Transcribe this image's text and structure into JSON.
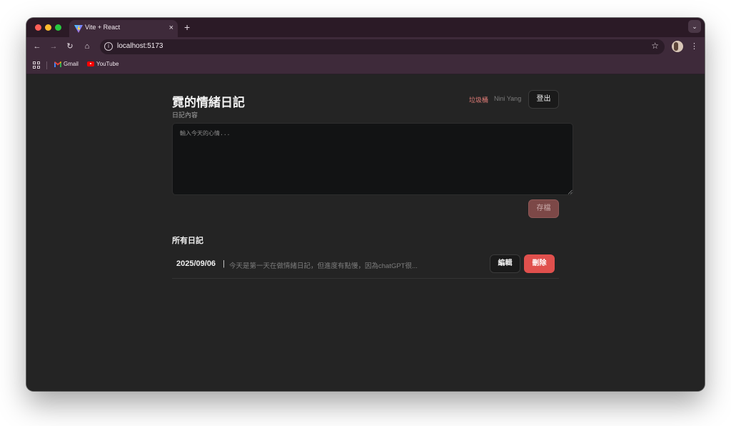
{
  "browser": {
    "tab_title": "Vite + React",
    "tab_close": "×",
    "new_tab": "+",
    "tab_menu": "⌄",
    "url": "localhost:5173",
    "nav": {
      "back": "←",
      "forward": "→",
      "reload": "↻",
      "home": "⌂"
    },
    "star": "☆",
    "menu": "⋮",
    "bookmarks": [
      {
        "label": "Gmail",
        "icon": "gmail-icon"
      },
      {
        "label": "YouTube",
        "icon": "youtube-icon"
      }
    ]
  },
  "app": {
    "title": "霓的情緒日記",
    "trash_link": "垃圾桶",
    "username": "Nini Yang",
    "logout_label": "登出",
    "field_label": "日記內容",
    "input_placeholder": "輸入今天的心情...",
    "input_value": "",
    "save_label": "存檔",
    "section_title": "所有日記",
    "entries": [
      {
        "date": "2025/09/06",
        "separator": "|",
        "preview": "今天是第一天在做情緒日記，但進度有點慢，因為chatGPT很...",
        "edit_label": "編輯",
        "delete_label": "刪除"
      }
    ]
  },
  "colors": {
    "page_bg": "#242424",
    "danger": "#e0504d",
    "save_disabled": "#7c4847",
    "link_accent": "#e27d78",
    "browser_frame": "#3e2a3a"
  }
}
